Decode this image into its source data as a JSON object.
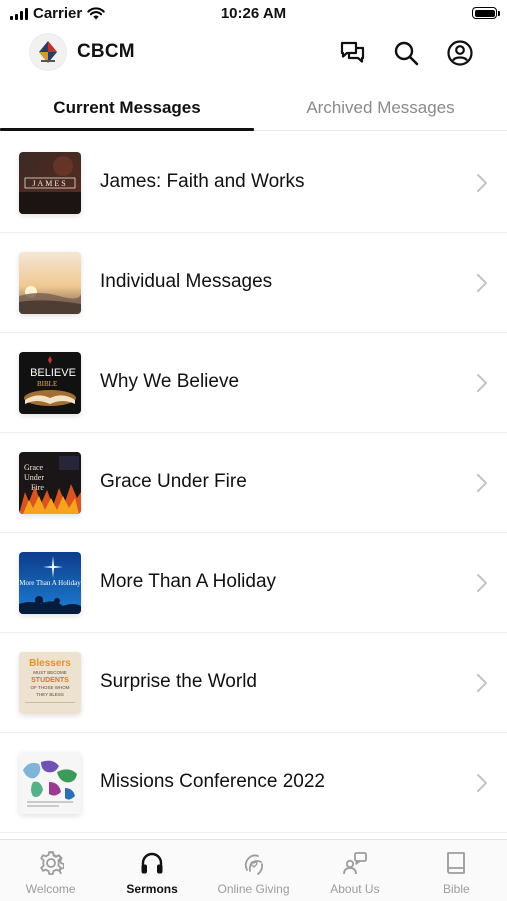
{
  "status_bar": {
    "carrier": "Carrier",
    "time": "10:26 AM"
  },
  "header": {
    "title": "CBCM",
    "icons": [
      "chat-bubbles-icon",
      "search-icon",
      "account-icon"
    ]
  },
  "tabs": [
    {
      "label": "Current Messages",
      "active": true
    },
    {
      "label": "Archived Messages",
      "active": false
    }
  ],
  "messages": [
    {
      "title": "James: Faith and Works",
      "thumb_text": "JAMES"
    },
    {
      "title": "Individual Messages",
      "thumb_text": ""
    },
    {
      "title": "Why We Believe",
      "thumb_text": "BELIEVE"
    },
    {
      "title": "Grace Under Fire",
      "thumb_text": "Grace Under Fire"
    },
    {
      "title": "More Than A Holiday",
      "thumb_text": "More Than A Holiday"
    },
    {
      "title": "Surprise the World",
      "thumb_text": "Blessers MUST BECOME STUDENTS OF THOSE WHOM THEY BLESS"
    },
    {
      "title": "Missions Conference 2022",
      "thumb_text": ""
    }
  ],
  "tabbar": [
    {
      "label": "Welcome",
      "icon": "gear-icon",
      "active": false
    },
    {
      "label": "Sermons",
      "icon": "headphones-icon",
      "active": true
    },
    {
      "label": "Online Giving",
      "icon": "giving-hand-icon",
      "active": false
    },
    {
      "label": "About Us",
      "icon": "about-us-icon",
      "active": false
    },
    {
      "label": "Bible",
      "icon": "book-icon",
      "active": false
    }
  ],
  "colors": {
    "text": "#111111",
    "muted": "#8a8a8a",
    "divider": "#ededed",
    "tabbar_bg": "#fafafa"
  }
}
